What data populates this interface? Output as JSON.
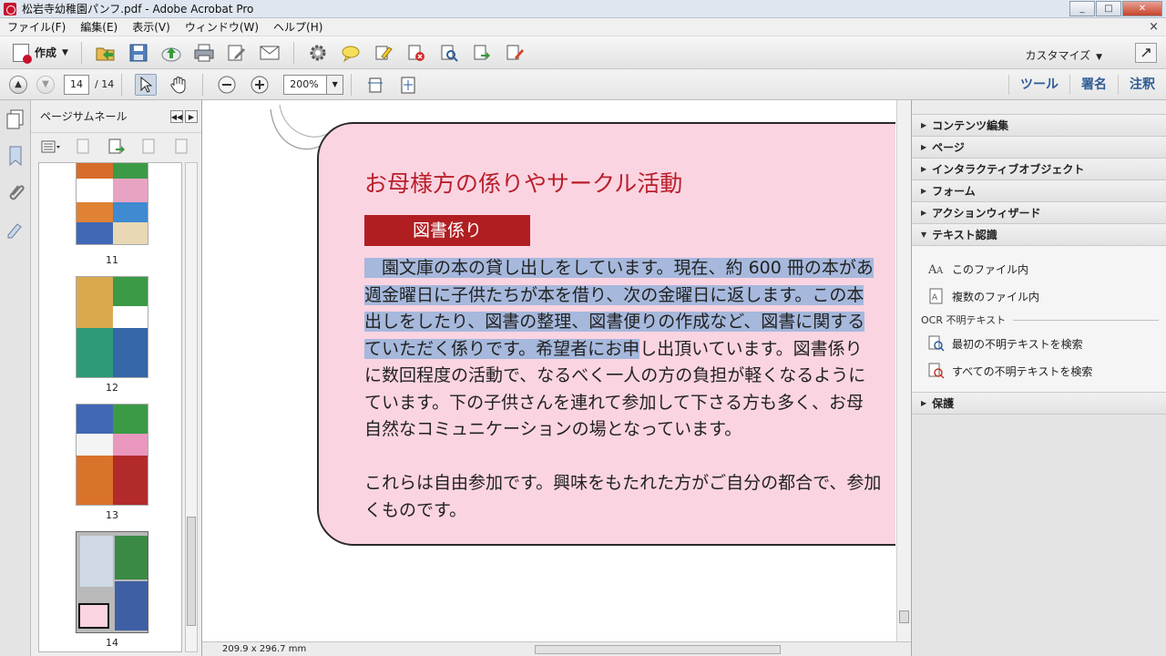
{
  "window": {
    "title": "松岩寺幼稚園パンフ.pdf - Adobe Acrobat Pro",
    "minimize": "_",
    "maximize": "□",
    "close": "✕"
  },
  "menu": {
    "items": [
      "ファイル(F)",
      "編集(E)",
      "表示(V)",
      "ウィンドウ(W)",
      "ヘルプ(H)"
    ],
    "close_doc": "×"
  },
  "toolbar": {
    "create_label": "作成",
    "customize_label": "カスタマイズ",
    "icons": [
      "open-icon",
      "save-icon",
      "upload-icon",
      "print-icon",
      "edit-icon",
      "email-icon",
      "gear-icon",
      "comment-icon",
      "highlight-icon",
      "delete-icon",
      "search-icon",
      "export-icon",
      "sign-icon"
    ]
  },
  "nav": {
    "current_page": "14",
    "total_pages": "/ 14",
    "zoom": "200%",
    "tabs": [
      "ツール",
      "署名",
      "注釈"
    ]
  },
  "sidebar": {
    "title": "ページサムネール",
    "thumbnails": [
      "11",
      "12",
      "13",
      "14"
    ],
    "selected_page": "14"
  },
  "document": {
    "heading": "お母様方の係りやサークル活動",
    "label": "図書係り",
    "lines": [
      {
        "pre": "",
        "hl": "　園文庫の本の貸し出しをしています。現在、約 600 冊の本があ",
        "post": ""
      },
      {
        "pre": "",
        "hl": "週金曜日に子供たちが本を借り、次の金曜日に返します。この本",
        "post": ""
      },
      {
        "pre": "",
        "hl": "出しをしたり、図書の整理、図書便りの作成など、図書に関する",
        "post": ""
      },
      {
        "pre": "",
        "hl": "ていただく係りです。希望者にお申",
        "post": "し出頂いています。図書係り"
      },
      {
        "pre": "に数回程度の活動で、なるべく一人の方の負担が軽くなるように",
        "hl": "",
        "post": ""
      },
      {
        "pre": "ています。下の子供さんを連れて参加して下さる方も多く、お母",
        "hl": "",
        "post": ""
      },
      {
        "pre": "自然なコミュニケーションの場となっています。",
        "hl": "",
        "post": ""
      },
      {
        "pre": "",
        "hl": "",
        "post": ""
      },
      {
        "pre": "これらは自由参加です。興味をもたれた方がご自分の都合で、参加",
        "hl": "",
        "post": ""
      },
      {
        "pre": "くものです。",
        "hl": "",
        "post": ""
      }
    ],
    "page_size": "209.9 x 296.7 mm"
  },
  "tools_panel": {
    "sections_top": [
      "コンテンツ編集",
      "ページ",
      "インタラクティブオブジェクト",
      "フォーム",
      "アクションウィザード"
    ],
    "open_section": "テキスト認識",
    "open_items": [
      "このファイル内",
      "複数のファイル内"
    ],
    "ocr_heading": "OCR 不明テキスト",
    "ocr_items": [
      "最初の不明テキストを検索",
      "すべての不明テキストを検索"
    ],
    "sections_bottom": [
      "保護"
    ]
  },
  "colors": {
    "card_pink": "#fbd4e2",
    "heading_red": "#b8202a",
    "label_red": "#b01e22",
    "highlight": "#a6b8dc",
    "tab_blue": "#2f5b95"
  }
}
